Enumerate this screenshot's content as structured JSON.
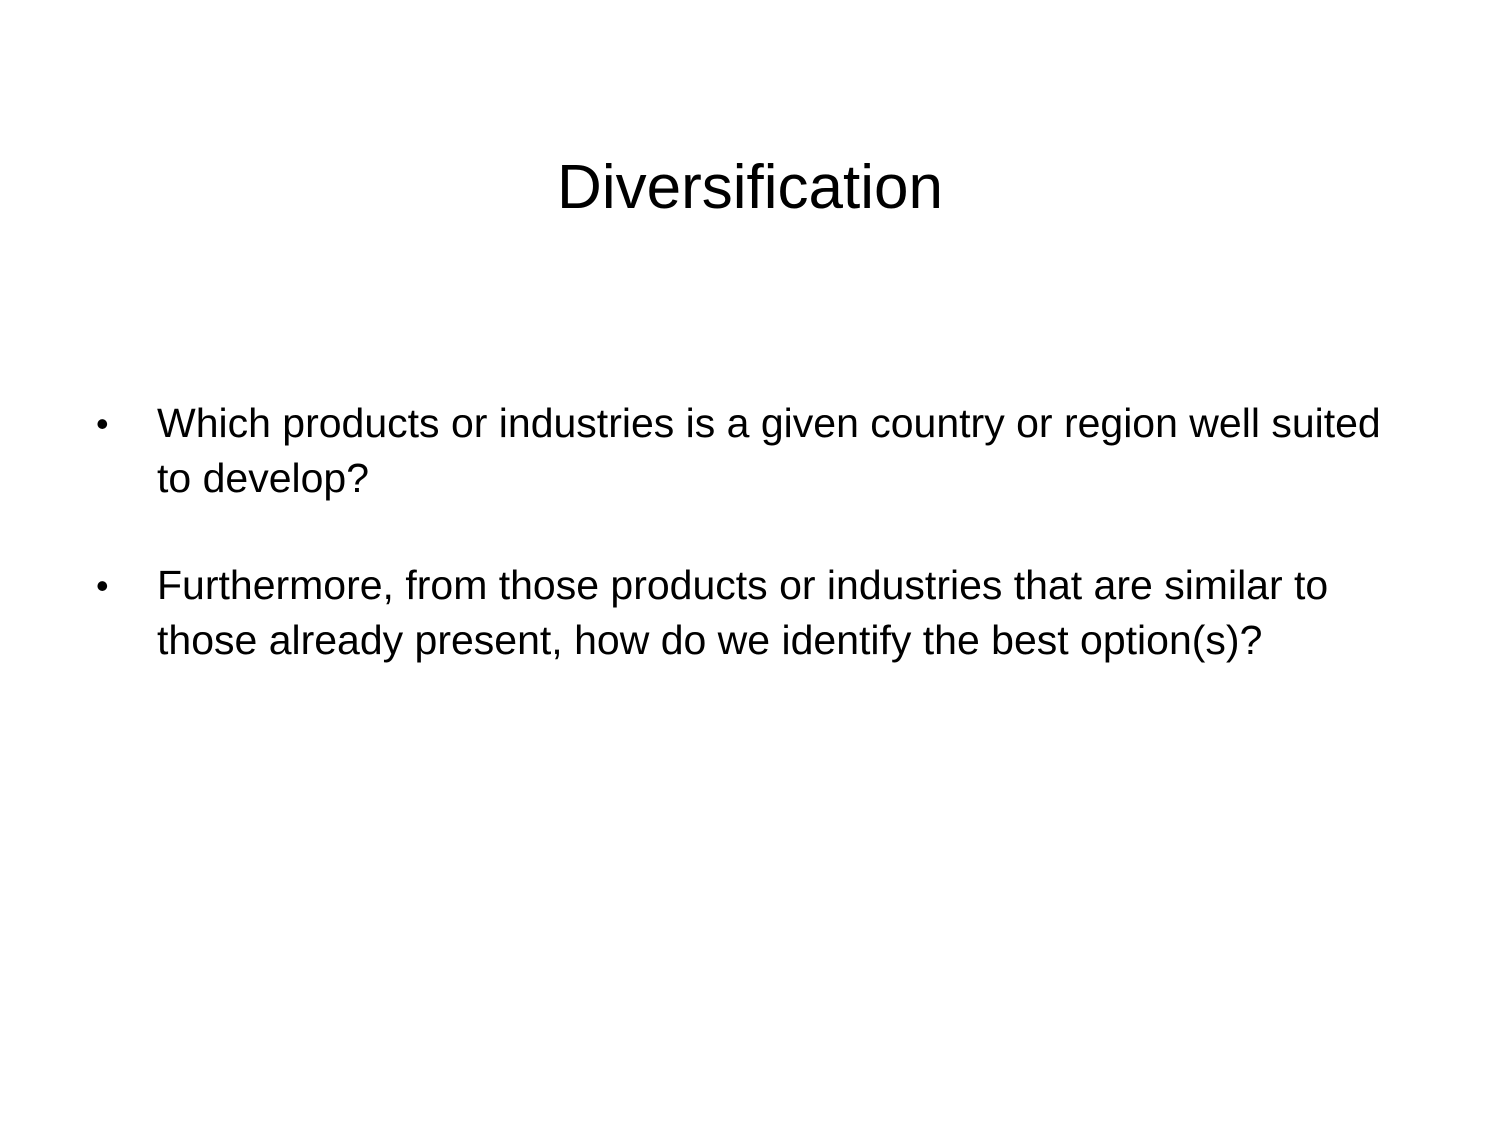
{
  "slide": {
    "title": "Diversification",
    "bullets": [
      {
        "marker": "•",
        "text": "Which products or industries is a given country or region well suited to develop?"
      },
      {
        "marker": "•",
        "text": "Furthermore, from those products or industries that are similar to those already present, how do we identify the best option(s)?"
      }
    ]
  }
}
